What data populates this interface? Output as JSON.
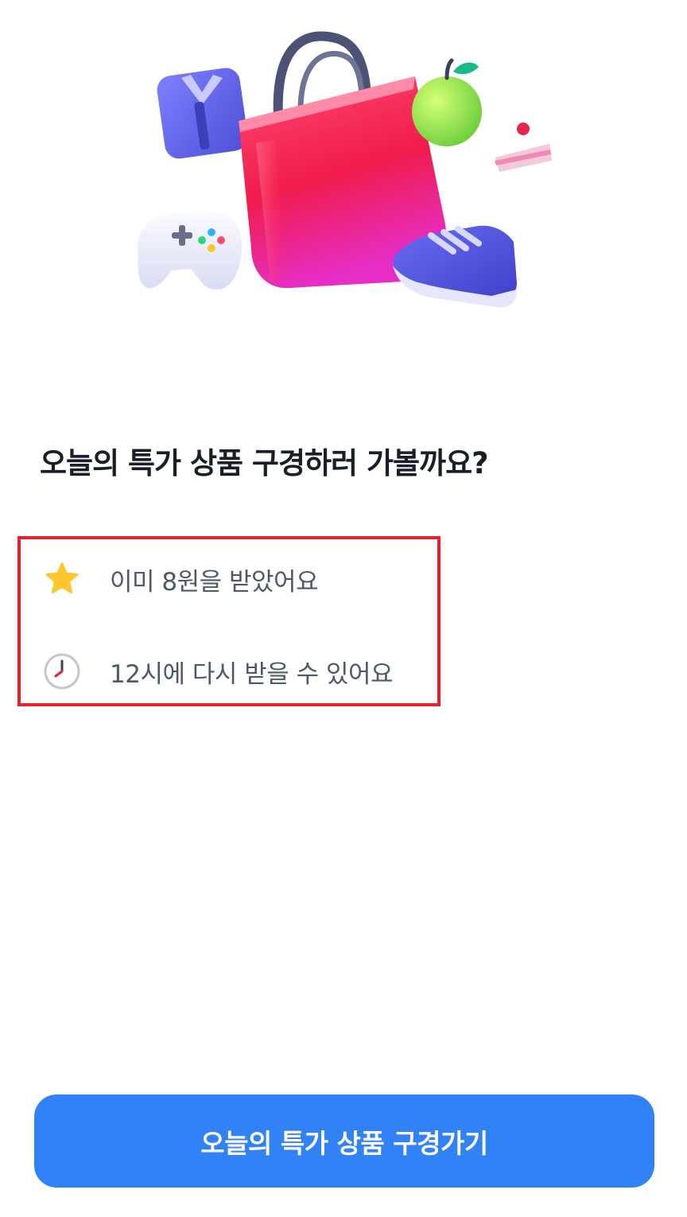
{
  "headline": "오늘의 특가 상품 구경하러 가볼까요?",
  "info_items": [
    {
      "icon": "star-icon",
      "text": "이미 8원을 받았어요"
    },
    {
      "icon": "clock-icon",
      "text": "12시에 다시 받을 수 있어요"
    }
  ],
  "cta": {
    "label": "오늘의 특가 상품 구경가기"
  },
  "colors": {
    "primary": "#3182f6",
    "highlight_border": "#e5222b",
    "headline": "#191f28",
    "body_text": "#4e5968",
    "star": "#ffc62e",
    "clock_hand": "#e5222b"
  }
}
